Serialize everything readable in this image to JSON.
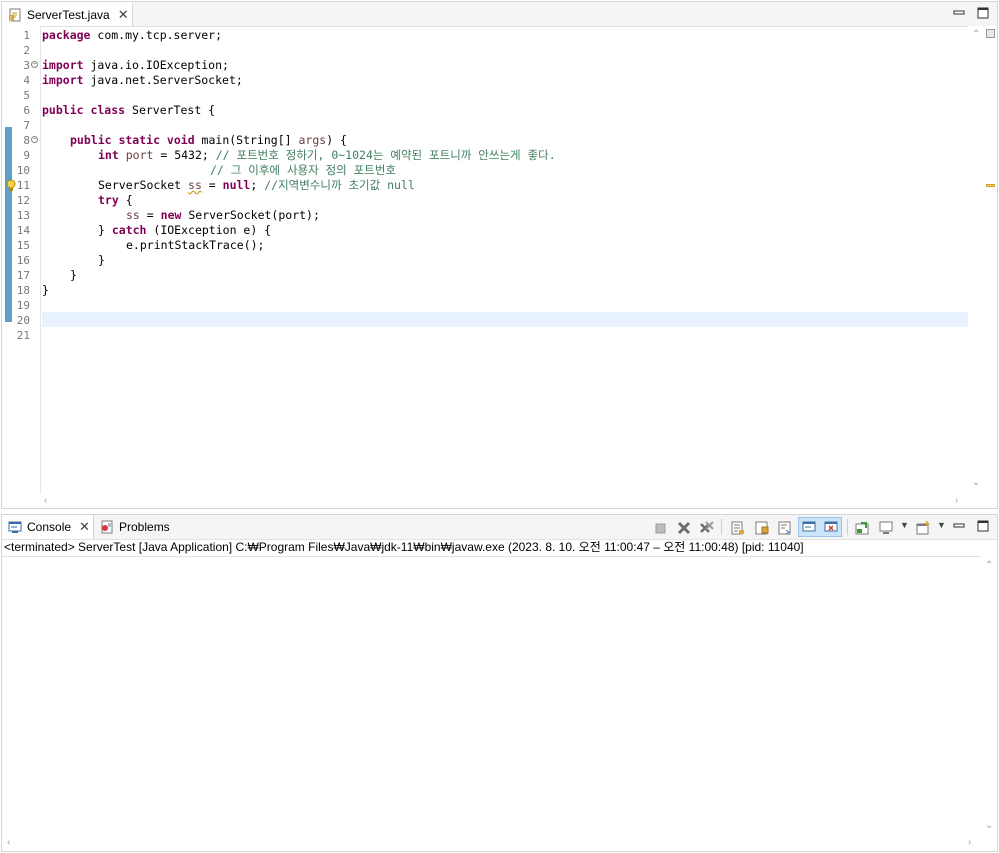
{
  "editor": {
    "tab_title": "ServerTest.java",
    "file_icon": "java-file-icon",
    "lines": [
      {
        "n": "1"
      },
      {
        "n": "2"
      },
      {
        "n": "3"
      },
      {
        "n": "4"
      },
      {
        "n": "5"
      },
      {
        "n": "6"
      },
      {
        "n": "7"
      },
      {
        "n": "8"
      },
      {
        "n": "9"
      },
      {
        "n": "10"
      },
      {
        "n": "11"
      },
      {
        "n": "12"
      },
      {
        "n": "13"
      },
      {
        "n": "14"
      },
      {
        "n": "15"
      },
      {
        "n": "16"
      },
      {
        "n": "17"
      },
      {
        "n": "18"
      },
      {
        "n": "19"
      },
      {
        "n": "20"
      },
      {
        "n": "21"
      }
    ],
    "code": {
      "l1_kw": "package",
      "l1_rest": " com.my.tcp.server;",
      "l3_kw": "import",
      "l3_rest": " java.io.IOException;",
      "l4_kw": "import",
      "l4_rest": " java.net.ServerSocket;",
      "l6_kw": "public class",
      "l6_rest": " ServerTest {",
      "l8_kw": "public static void",
      "l8_rest": " main(String[] ",
      "l8_var": "args",
      "l8_end": ") {",
      "l9_kw": "int",
      "l9_var": "port",
      "l9_rest": " = 5432; ",
      "l9_cm": "// 포트번호 정하기, 0~1024는 예약된 포트니까 안쓰는게 좋다.",
      "l10_cm": "// 그 이후에 사용자 정의 포트번호",
      "l11_type": "ServerSocket ",
      "l11_var": "ss",
      "l11_mid": " = ",
      "l11_kw": "null",
      "l11_semi": "; ",
      "l11_cm": "//지역변수니까 초기값 null",
      "l12_kw": "try",
      "l12_rest": " {",
      "l13_var": "ss",
      "l13_mid": " = ",
      "l13_kw": "new",
      "l13_rest": " ServerSocket(port);",
      "l14_pre": "} ",
      "l14_kw": "catch",
      "l14_rest": " (IOException e) {",
      "l15_rest": "e.printStackTrace();",
      "l16_rest": "}",
      "l17_rest": "}",
      "l18_rest": "}"
    },
    "colors": {
      "keyword": "#7f0055",
      "comment": "#3f7f5f",
      "variable": "#6a3e3e",
      "current_line": "#e8f2fe",
      "change_bar": "#5f9ec9"
    }
  },
  "console": {
    "tab_console": "Console",
    "tab_problems": "Problems",
    "status": "<terminated> ServerTest [Java Application] C:₩Program Files₩Java₩jdk-11₩bin₩javaw.exe  (2023. 8. 10. 오전 11:00:47 – 오전 11:00:48) [pid: 11040]"
  }
}
